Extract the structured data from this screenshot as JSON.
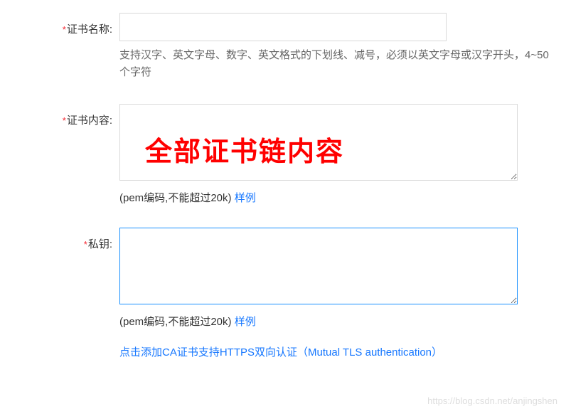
{
  "fields": {
    "cert_name": {
      "label": "证书名称:",
      "value": "",
      "hint": "支持汉字、英文字母、数字、英文格式的下划线、减号，必须以英文字母或汉字开头，4~50个字符"
    },
    "cert_content": {
      "label": "证书内容:",
      "value": "",
      "overlay": "全部证书链内容",
      "hint_prefix": "(pem编码,不能超过20k) ",
      "sample_link": "样例"
    },
    "private_key": {
      "label": "私钥:",
      "value": "",
      "hint_prefix": "(pem编码,不能超过20k) ",
      "sample_link": "样例"
    }
  },
  "ca_link": "点击添加CA证书支持HTTPS双向认证（Mutual TLS authentication）",
  "watermark": "https://blog.csdn.net/anjingshen"
}
